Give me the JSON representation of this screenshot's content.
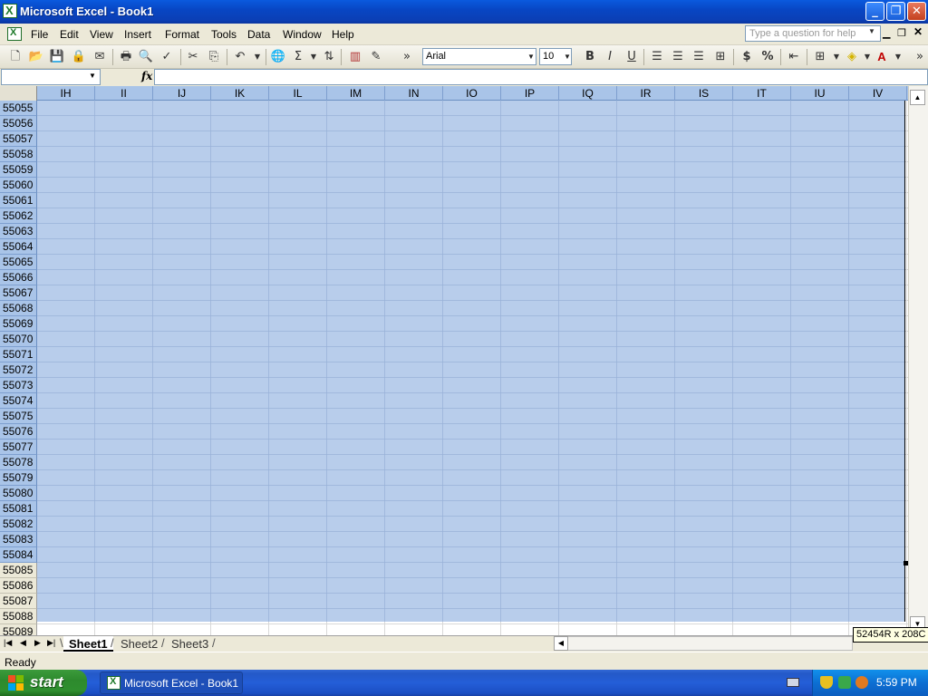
{
  "window": {
    "title": "Microsoft Excel - Book1",
    "min_glyph": "_",
    "max_glyph": "❐",
    "close_glyph": "✕"
  },
  "menu": {
    "items": [
      "File",
      "Edit",
      "View",
      "Insert",
      "Format",
      "Tools",
      "Data",
      "Window",
      "Help"
    ],
    "help_placeholder": "Type a question for help"
  },
  "toolbar": {
    "font": "Arial",
    "size": "10",
    "bold": "B",
    "italic": "I",
    "underline": "U",
    "currency": "$",
    "percent": "%",
    "sum": "Σ",
    "chevron": "»"
  },
  "formula": {
    "fx": "fx",
    "namebox": "",
    "value": ""
  },
  "grid": {
    "columns": [
      "IH",
      "II",
      "IJ",
      "IK",
      "IL",
      "IM",
      "IN",
      "IO",
      "IP",
      "IQ",
      "IR",
      "IS",
      "IT",
      "IU",
      "IV"
    ],
    "rows": [
      "55055",
      "55056",
      "55057",
      "55058",
      "55059",
      "55060",
      "55061",
      "55062",
      "55063",
      "55064",
      "55065",
      "55066",
      "55067",
      "55068",
      "55069",
      "55070",
      "55071",
      "55072",
      "55073",
      "55074",
      "55075",
      "55076",
      "55077",
      "55078",
      "55079",
      "55080",
      "55081",
      "55082",
      "55083",
      "55084",
      "55085",
      "55086",
      "55087",
      "55088",
      "55089"
    ],
    "selection_size": "52454R x 208C",
    "selection_color": "#acc4e8"
  },
  "sheets": {
    "tabs": [
      "Sheet1",
      "Sheet2",
      "Sheet3"
    ],
    "active": "Sheet1"
  },
  "status": {
    "text": "Ready"
  },
  "taskbar": {
    "start_label": "start",
    "task_label": "Microsoft Excel - Book1",
    "clock": "5:59 PM"
  }
}
